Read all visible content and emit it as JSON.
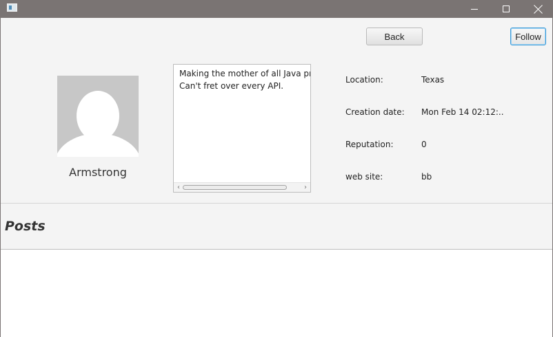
{
  "window": {
    "title_icon": "window-app-icon",
    "controls": [
      "minimize-icon",
      "maximize-icon",
      "close-icon"
    ]
  },
  "toolbar": {
    "back_label": "Back",
    "follow_label": "Follow"
  },
  "profile": {
    "username": "Armstrong",
    "bio": "Making the mother of all Java programs.\nCan't fret over every API."
  },
  "details": {
    "location_label": "Location:",
    "location_value": "Texas",
    "creation_label": "Creation date:",
    "creation_value": "Mon Feb 14 02:12:...",
    "reputation_label": "Reputation:",
    "reputation_value": "0",
    "website_label": "web site:",
    "website_value": "bb"
  },
  "posts": {
    "title": "Posts",
    "items": []
  },
  "colors": {
    "titlebar": "#7a7473",
    "background": "#f4f4f4",
    "focus_accent": "#3b9bd7"
  }
}
